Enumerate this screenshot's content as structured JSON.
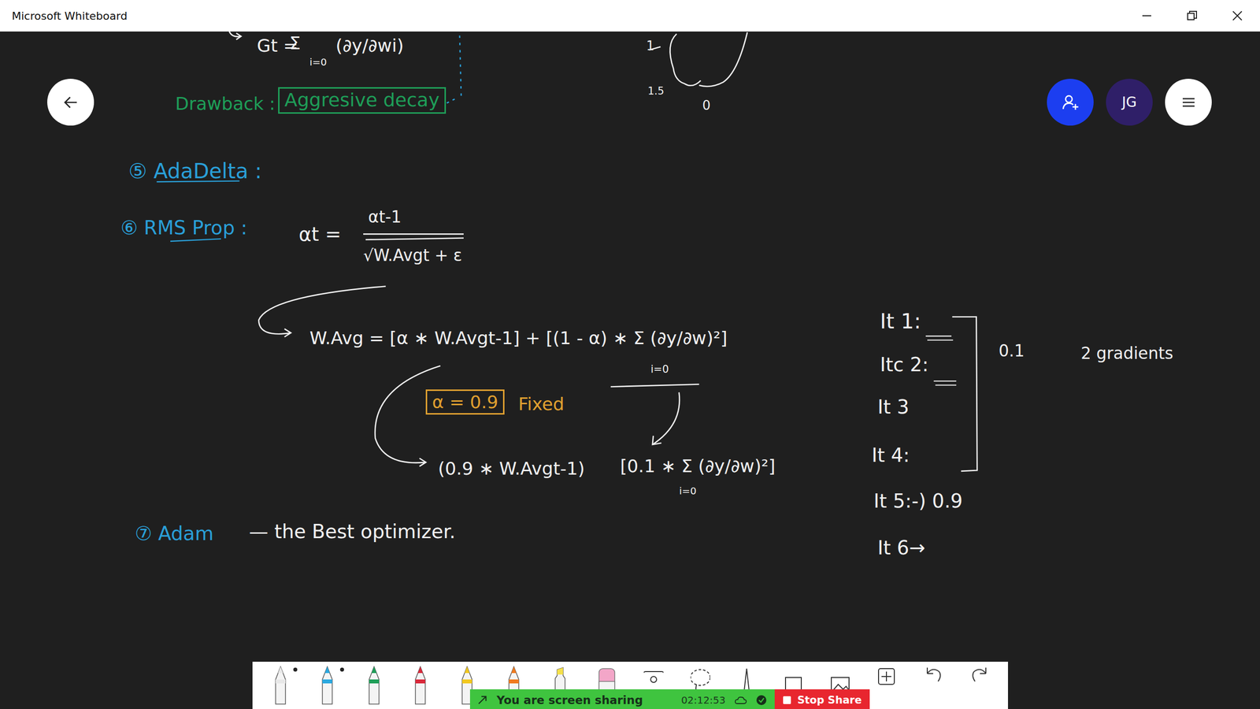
{
  "window": {
    "title": "Microsoft Whiteboard"
  },
  "header": {
    "avatar": "JG"
  },
  "canvas": {
    "ink": [
      {
        "text": "Gt =",
        "color": "#f0f0f0",
        "boxed": false
      },
      {
        "text": "Σ",
        "color": "#f0f0f0",
        "boxed": false
      },
      {
        "text": "i=0",
        "color": "#f0f0f0",
        "boxed": false
      },
      {
        "text": "(∂y/∂wi)",
        "color": "#f0f0f0",
        "boxed": false
      },
      {
        "text": "1",
        "color": "#f0f0f0",
        "boxed": false
      },
      {
        "text": "1.5",
        "color": "#f0f0f0",
        "boxed": false
      },
      {
        "text": "0",
        "color": "#f0f0f0",
        "boxed": false
      },
      {
        "text": "Drawback :",
        "color": "#1e9e58",
        "boxed": false
      },
      {
        "text": "Aggresive decay",
        "color": "#1e9e58",
        "boxed": true
      },
      {
        "text": "⑤ AdaDelta :",
        "color": "#2a9fd8",
        "boxed": false
      },
      {
        "text": "⑥ RMS Prop :",
        "color": "#2a9fd8",
        "boxed": false
      },
      {
        "text": "αt =",
        "color": "#f0f0f0",
        "boxed": false
      },
      {
        "text": "αt-1",
        "color": "#f0f0f0",
        "boxed": false
      },
      {
        "text": "√W.Avgt + ε",
        "color": "#f0f0f0",
        "boxed": false
      },
      {
        "text": "W.Avg = [α ∗ W.Avgt-1] + [(1 - α) ∗ Σ (∂y/∂w)²]",
        "color": "#f0f0f0",
        "boxed": false
      },
      {
        "text": "i=0",
        "color": "#f0f0f0",
        "boxed": false
      },
      {
        "text": "α = 0.9",
        "color": "#e0a030",
        "boxed": true
      },
      {
        "text": "Fixed",
        "color": "#e0a030",
        "boxed": false
      },
      {
        "text": "(0.9 ∗ W.Avgt-1)",
        "color": "#f0f0f0",
        "boxed": false
      },
      {
        "text": "[0.1 ∗ Σ (∂y/∂w)²]",
        "color": "#f0f0f0",
        "boxed": false
      },
      {
        "text": "i=0",
        "color": "#f0f0f0",
        "boxed": false
      },
      {
        "text": "⑦ Adam",
        "color": "#2a9fd8",
        "boxed": false
      },
      {
        "text": "— the Best optimizer.",
        "color": "#f0f0f0",
        "boxed": false
      },
      {
        "text": "It 1:",
        "color": "#f0f0f0",
        "boxed": false
      },
      {
        "text": "Itc 2:",
        "color": "#f0f0f0",
        "boxed": false
      },
      {
        "text": "It 3",
        "color": "#f0f0f0",
        "boxed": false
      },
      {
        "text": "It 4:",
        "color": "#f0f0f0",
        "boxed": false
      },
      {
        "text": "It 5:-) 0.9",
        "color": "#f0f0f0",
        "boxed": false
      },
      {
        "text": "It 6→",
        "color": "#f0f0f0",
        "boxed": false
      },
      {
        "text": "0.1",
        "color": "#f0f0f0",
        "boxed": false
      },
      {
        "text": "2 gradients",
        "color": "#f0f0f0",
        "boxed": false
      }
    ]
  },
  "toolbar": {
    "tools": [
      {
        "kind": "pen",
        "color": "#e8e8e8",
        "dot": true
      },
      {
        "kind": "pen",
        "color": "#2aa8e0",
        "dot": true
      },
      {
        "kind": "pen",
        "color": "#1e9e58",
        "dot": false
      },
      {
        "kind": "pen",
        "color": "#d9283a",
        "dot": false
      },
      {
        "kind": "pen",
        "color": "#f2c81e",
        "dot": false
      },
      {
        "kind": "pen",
        "color": "#f07a1e",
        "dot": false
      },
      {
        "kind": "highlighter",
        "color": "#f4e04a",
        "dot": false
      },
      {
        "kind": "eraser",
        "color": "#f3a6c8",
        "dot": false
      },
      {
        "kind": "ruler",
        "color": "#333333",
        "dot": false
      },
      {
        "kind": "lasso",
        "color": "#333333",
        "dot": false
      },
      {
        "kind": "inkpen",
        "color": "#333333",
        "dot": false
      },
      {
        "kind": "shape",
        "color": "#333333",
        "dot": false
      },
      {
        "kind": "image",
        "color": "#333333",
        "dot": false
      },
      {
        "kind": "add",
        "color": "#333333",
        "dot": false
      },
      {
        "kind": "undo",
        "color": "#333333",
        "dot": false
      },
      {
        "kind": "redo",
        "color": "#333333",
        "dot": false
      }
    ]
  },
  "share_banner": {
    "message": "You are screen sharing",
    "timer": "02:12:53",
    "stop": "Stop Share"
  }
}
